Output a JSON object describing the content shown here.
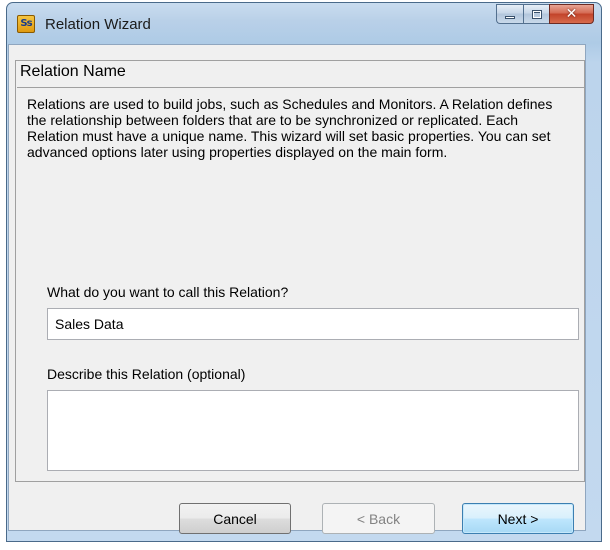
{
  "window": {
    "title": "Relation Wizard",
    "app_icon_text": "Ss",
    "caption_buttons": {
      "minimize_icon": "minimize-icon",
      "maximize_icon": "maximize-icon",
      "close_glyph": "✕"
    }
  },
  "page": {
    "header": "Relation Name",
    "intro_text": "Relations are used to build jobs, such as Schedules and Monitors. A Relation defines the relationship between folders that are to be synchronized or replicated. Each Relation must have a unique name. This wizard will set basic properties. You can set advanced options later using properties displayed on the main form."
  },
  "form": {
    "name_label": "What do you want to call this Relation?",
    "name_value": "Sales Data",
    "description_label": "Describe this Relation (optional)",
    "description_value": ""
  },
  "buttons": {
    "cancel": "Cancel",
    "back": "< Back",
    "next": "Next >"
  },
  "colors": {
    "window_frame": "#aecbe6",
    "client_background": "#f0f0f0",
    "close_button": "#c2432a",
    "default_button_border": "#3c7fb1"
  }
}
